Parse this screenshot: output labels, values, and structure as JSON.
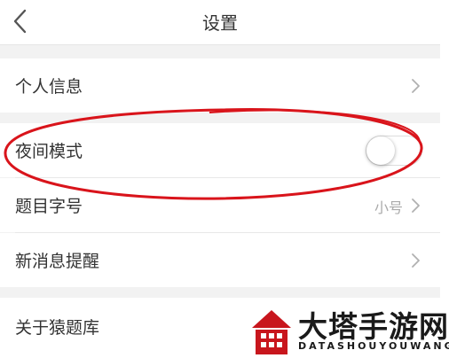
{
  "nav": {
    "title": "设置"
  },
  "sections": [
    {
      "rows": [
        {
          "label": "个人信息"
        }
      ]
    },
    {
      "rows": [
        {
          "label": "夜间模式",
          "toggle_on": false
        },
        {
          "label": "题目字号",
          "value": "小号"
        },
        {
          "label": "新消息提醒"
        }
      ]
    },
    {
      "rows": [
        {
          "label": "关于猿题库"
        }
      ]
    }
  ],
  "colors": {
    "annotation": "#d9141b",
    "watermark_red": "#c8161d",
    "background": "#f2f2f2"
  },
  "watermark": {
    "title": "大塔手游网",
    "subtitle": "DATASHOUYOUWANG"
  }
}
